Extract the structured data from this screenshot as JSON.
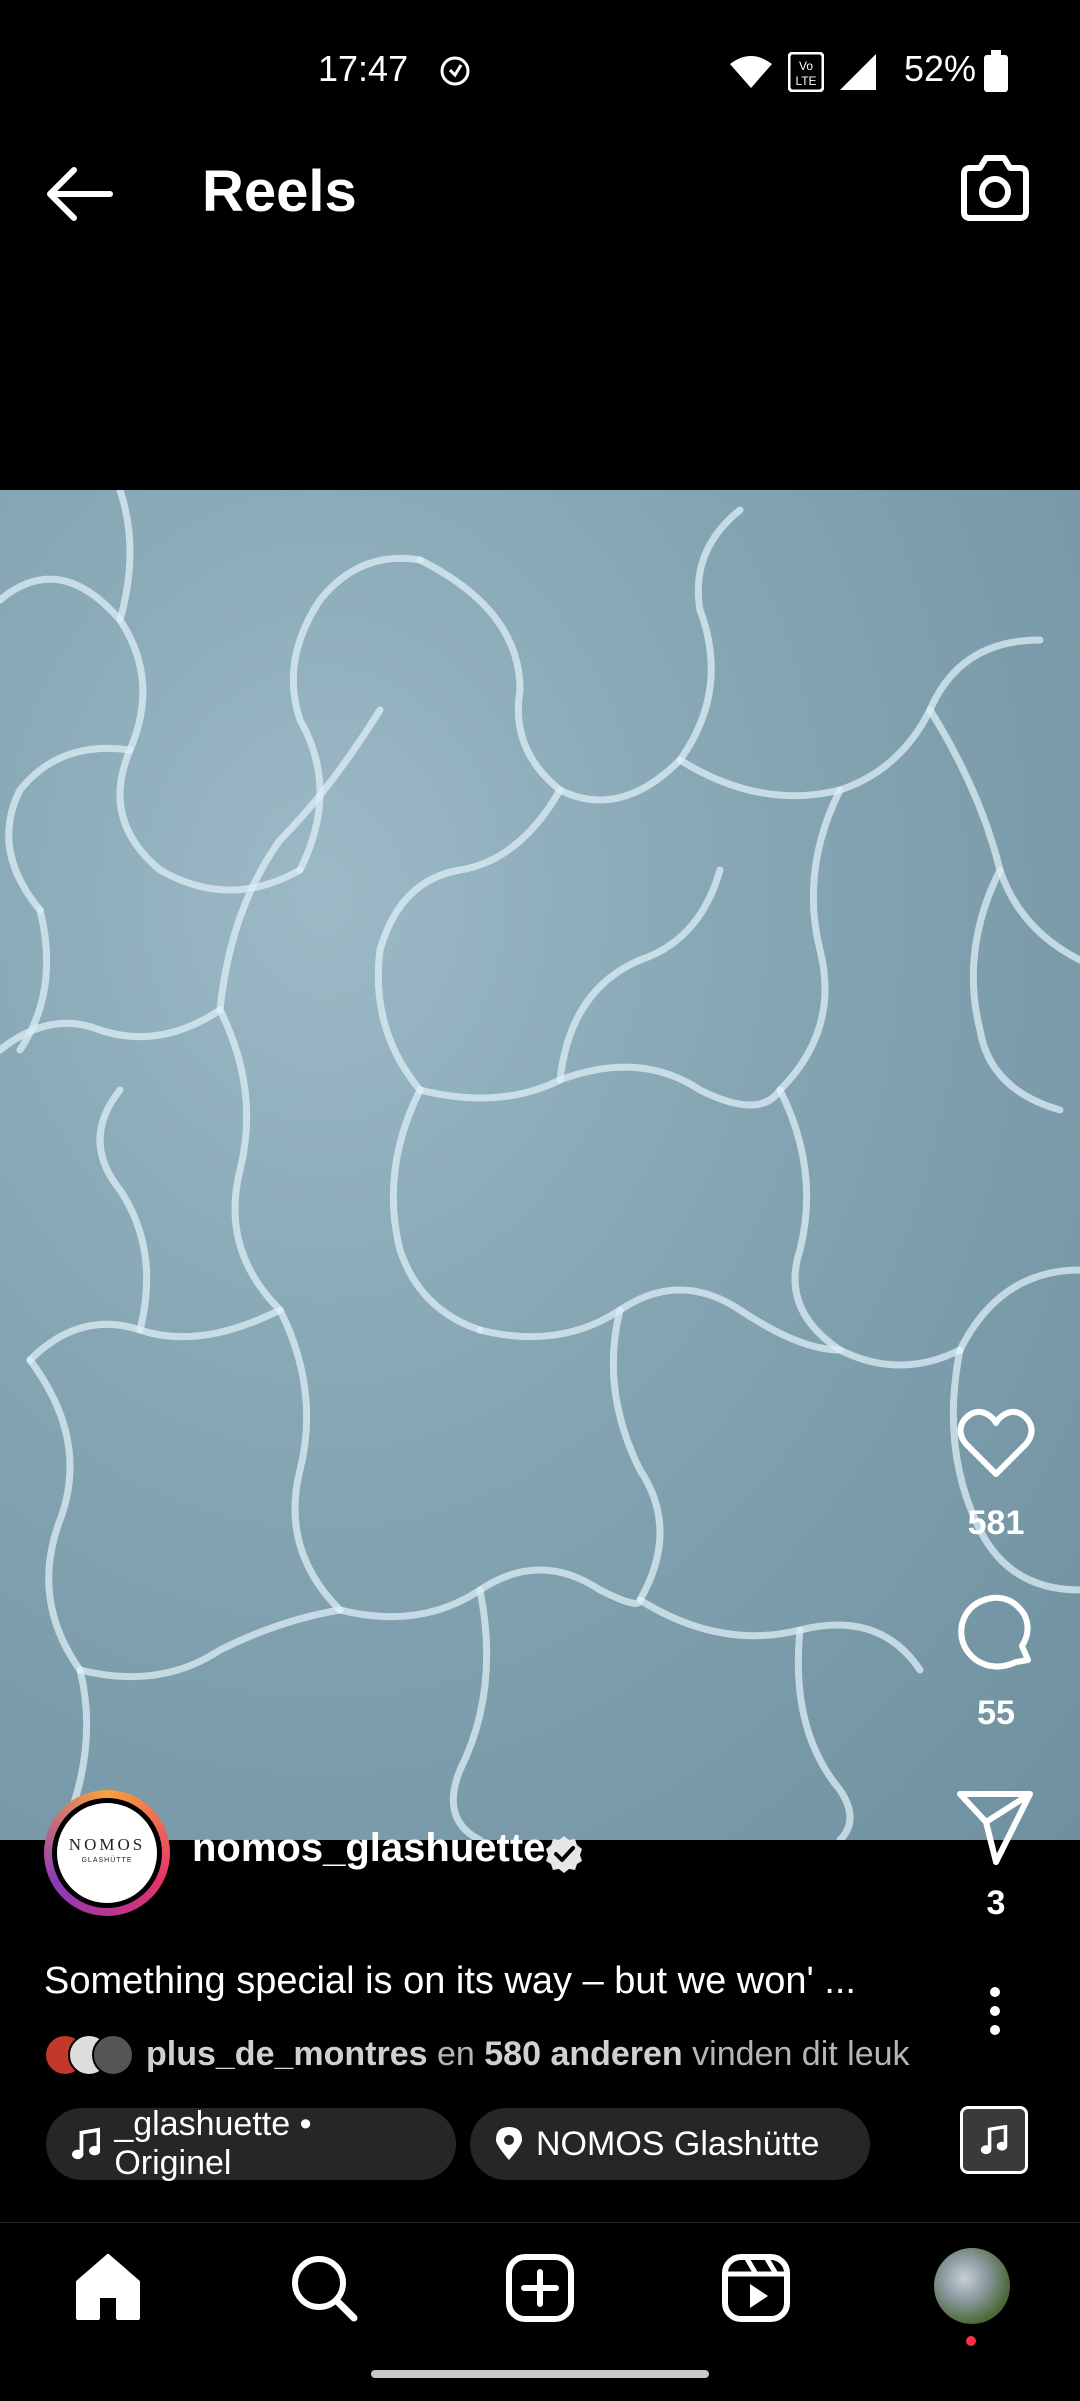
{
  "status_bar": {
    "time": "17:47",
    "battery_percent": "52%",
    "icons": [
      "alarm-icon",
      "wifi-icon",
      "volte-icon",
      "signal-icon",
      "battery-icon"
    ]
  },
  "header": {
    "title": "Reels",
    "back_icon": "back-arrow-icon",
    "camera_icon": "camera-icon"
  },
  "reel": {
    "author": {
      "username": "nomos_glashuette",
      "verified": true,
      "avatar_text": "NOMOS",
      "avatar_subtext": "GLASHÜTTE"
    },
    "caption": "Something special is on its way – but we won' ...",
    "likes": {
      "first_user": "plus_de_montres",
      "connector": "en",
      "others": "580 anderen",
      "suffix": "vinden dit leuk"
    },
    "audio_label": "_glashuette • Originel",
    "location_label": "NOMOS Glashütte",
    "actions": {
      "like_count": "581",
      "comment_count": "55",
      "share_count": "3"
    }
  },
  "bottom_nav": {
    "items": [
      "home",
      "search",
      "create",
      "reels",
      "profile"
    ]
  },
  "colors": {
    "background": "#000000",
    "pill": "#262626",
    "water": "#86a6b4",
    "notification_dot": "#ff3040"
  }
}
